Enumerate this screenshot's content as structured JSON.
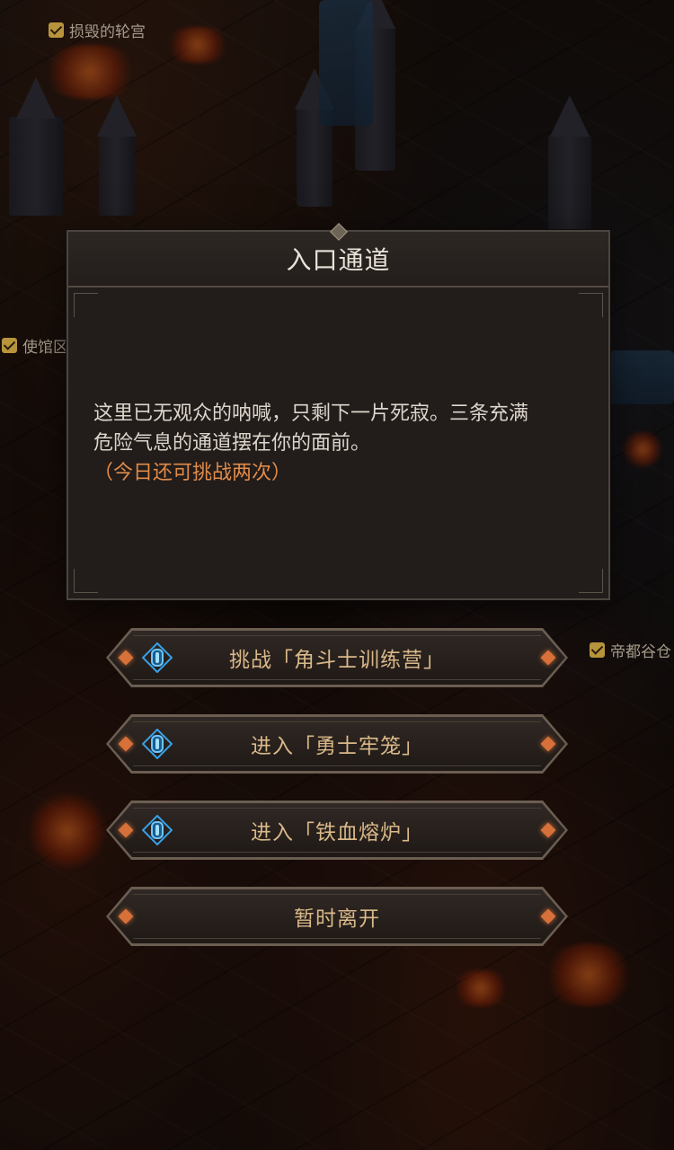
{
  "map_labels": [
    "损毁的轮宫",
    "使馆区",
    "帝都谷仓"
  ],
  "dialog": {
    "title": "入口通道",
    "description_line1": "这里已无观众的呐喊，只剩下一片死寂。三条充满",
    "description_line2": "危险气息的通道摆在你的面前。",
    "note": "（今日还可挑战两次）"
  },
  "choices": [
    {
      "label": "挑战「角斗士训练营」",
      "icon": "blue-crystal-icon"
    },
    {
      "label": "进入「勇士牢笼」",
      "icon": "blue-crystal-icon"
    },
    {
      "label": "进入「铁血熔炉」",
      "icon": "blue-crystal-icon"
    },
    {
      "label": "暂时离开"
    }
  ],
  "colors": {
    "note_orange": "#e08b4a",
    "button_text": "#d9b889",
    "crystal_blue": "#38a0e6",
    "ornament_orange": "#d8703a"
  }
}
